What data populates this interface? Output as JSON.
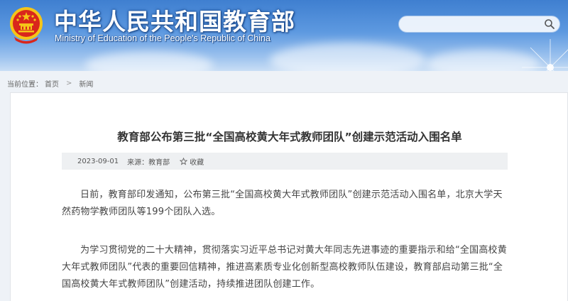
{
  "header": {
    "title_cn": "中华人民共和国教育部",
    "title_en": "Ministry of Education of the People's Republic of China",
    "search": {
      "placeholder": "",
      "value": ""
    },
    "icons": {
      "emblem": "national-emblem",
      "search": "search-icon",
      "decor": "dandelion-decoration"
    }
  },
  "breadcrumb": {
    "label": "当前位置：",
    "items": [
      "首页",
      "新闻"
    ],
    "separator": ">"
  },
  "article": {
    "title": "教育部公布第三批“全国高校黄大年式教师团队”创建示范活动入围名单",
    "date": "2023-09-01",
    "source": "来源：教育部",
    "favorite_label": "收藏",
    "paragraphs": [
      "日前，教育部印发通知，公布第三批“全国高校黄大年式教师团队”创建示范活动入围名单，北京大学天然药物学教师团队等199个团队入选。",
      "为学习贯彻党的二十大精神，贯彻落实习近平总书记对黄大年同志先进事迹的重要指示和给“全国高校黄大年式教师团队”代表的重要回信精神，推进高素质专业化创新型高校教师队伍建设，教育部启动第三批“全国高校黄大年式教师团队”创建活动，持续推进团队创建工作。"
    ]
  },
  "colors": {
    "banner_top": "#3f7fd0",
    "banner_bottom": "#c9def5",
    "emblem_red": "#d9261c",
    "emblem_gold": "#f5c518",
    "text": "#444444",
    "meta_bg": "#eef0f2"
  }
}
